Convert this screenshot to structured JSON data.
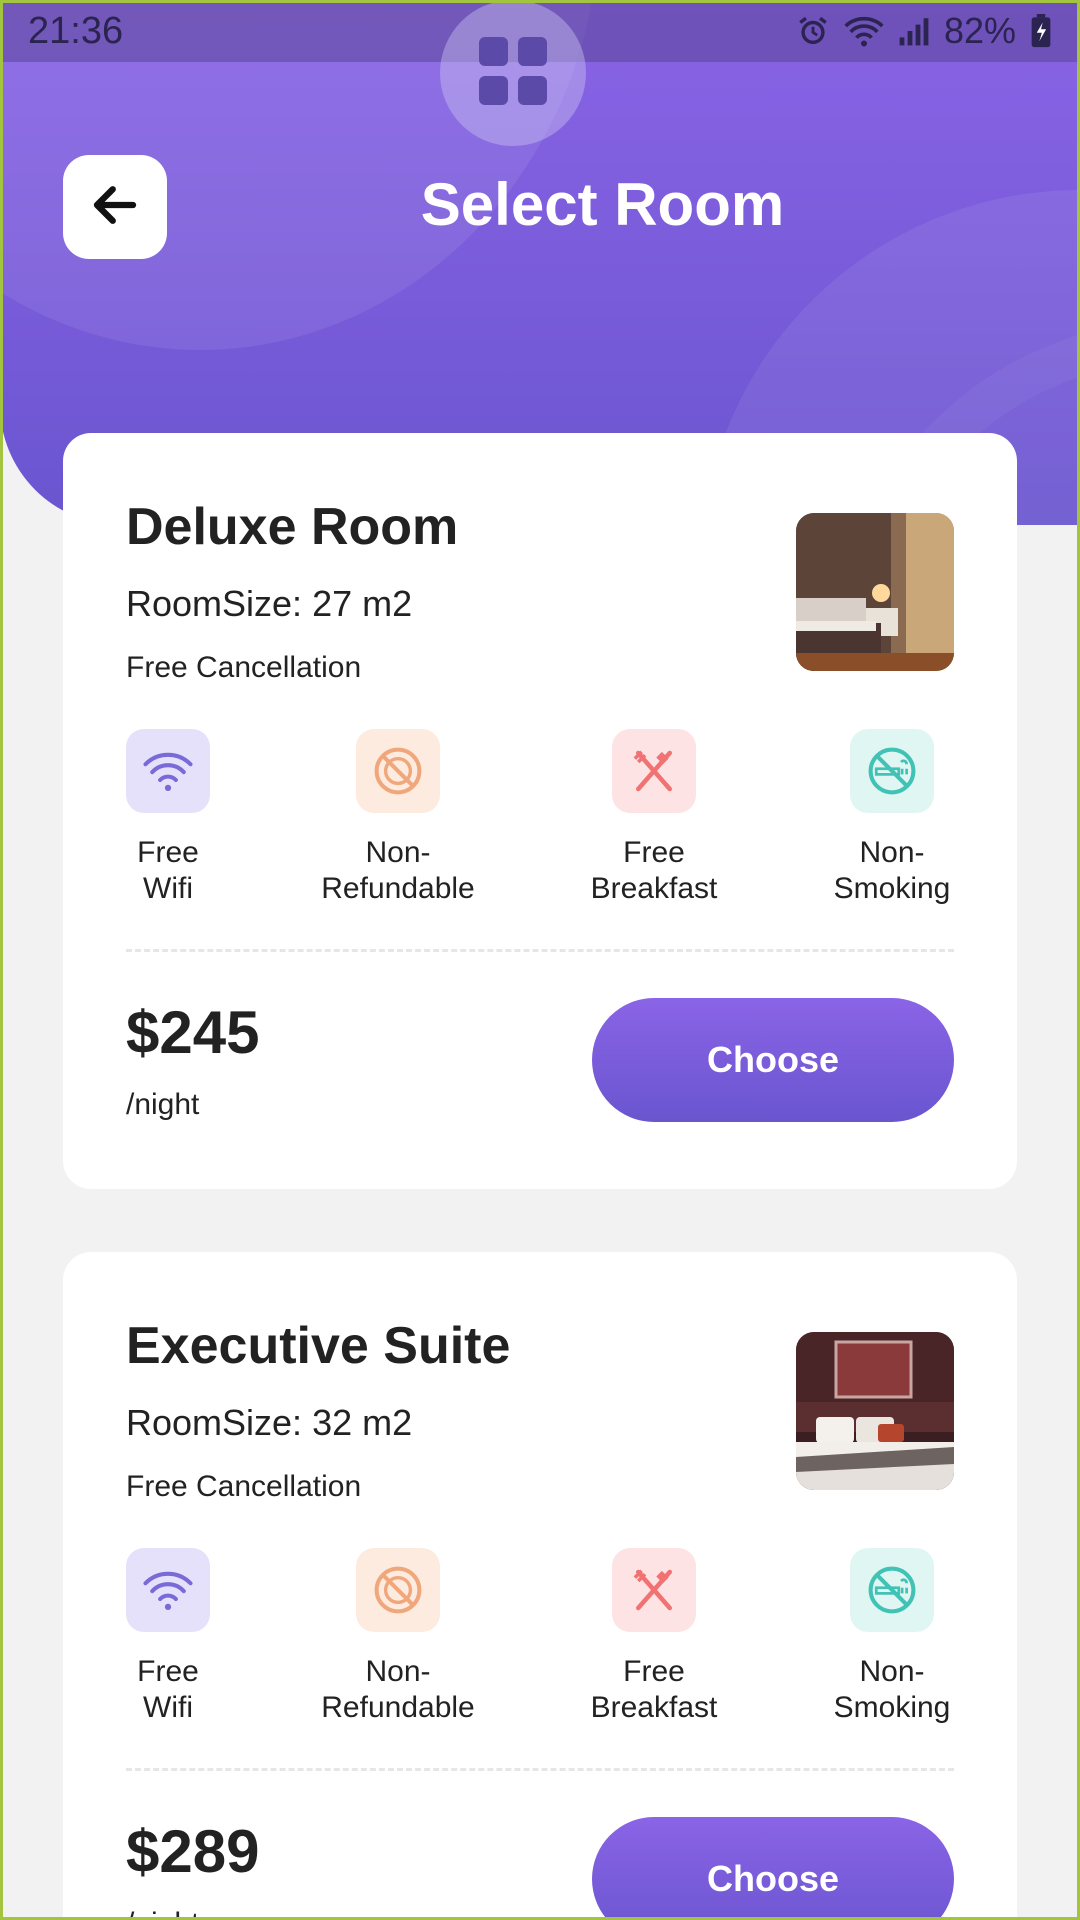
{
  "status_bar": {
    "time": "21:36",
    "battery": "82%"
  },
  "header": {
    "title": "Select Room"
  },
  "rooms": [
    {
      "name": "Deluxe Room",
      "size": "RoomSize: 27 m2",
      "cancellation": "Free Cancellation",
      "amenities": [
        {
          "line1": "Free",
          "line2": "Wifi",
          "icon": "wifi-icon",
          "color": "#7a6ad8",
          "bg": "#e5e1fb"
        },
        {
          "line1": "Non-",
          "line2": "Refundable",
          "icon": "no-refund-icon",
          "color": "#f0a77c",
          "bg": "#fdebe0"
        },
        {
          "line1": "Free",
          "line2": "Breakfast",
          "icon": "fork-knife-icon",
          "color": "#f07272",
          "bg": "#fde3e3"
        },
        {
          "line1": "Non-",
          "line2": "Smoking",
          "icon": "no-smoking-icon",
          "color": "#40c2b5",
          "bg": "#dff6f3"
        }
      ],
      "price": "$245",
      "per": "/night",
      "button": "Choose"
    },
    {
      "name": "Executive Suite",
      "size": "RoomSize: 32 m2",
      "cancellation": "Free Cancellation",
      "amenities": [
        {
          "line1": "Free",
          "line2": "Wifi",
          "icon": "wifi-icon",
          "color": "#7a6ad8",
          "bg": "#e5e1fb"
        },
        {
          "line1": "Non-",
          "line2": "Refundable",
          "icon": "no-refund-icon",
          "color": "#f0a77c",
          "bg": "#fdebe0"
        },
        {
          "line1": "Free",
          "line2": "Breakfast",
          "icon": "fork-knife-icon",
          "color": "#f07272",
          "bg": "#fde3e3"
        },
        {
          "line1": "Non-",
          "line2": "Smoking",
          "icon": "no-smoking-icon",
          "color": "#40c2b5",
          "bg": "#dff6f3"
        }
      ],
      "price": "$289",
      "per": "/night",
      "button": "Choose"
    }
  ],
  "colors": {
    "accent": "#7b5ddc",
    "header_top": "#8a64e6",
    "header_bottom": "#6a55cf"
  }
}
